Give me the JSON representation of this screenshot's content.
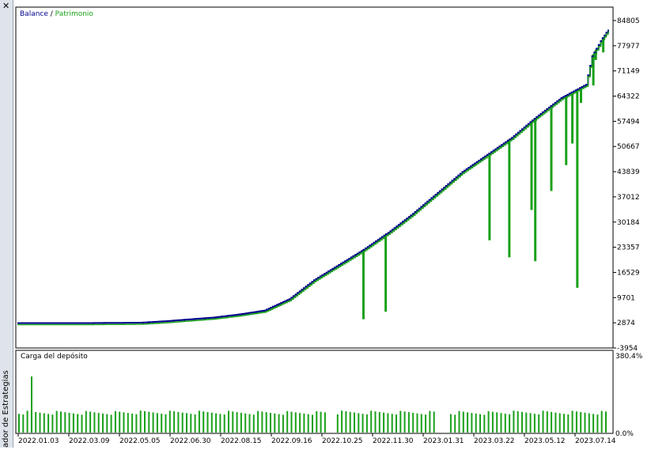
{
  "window": {
    "side_title": "ador de Estrategias",
    "close_glyph": "✕"
  },
  "legend": {
    "balance_label": "Balance",
    "separator": " / ",
    "equity_label": "Patrimonio",
    "balance_color": "#00008b",
    "equity_color": "#1aa11a"
  },
  "lower_panel": {
    "title": "Carga del depósito",
    "bar_color": "#1aa11a"
  },
  "chart_data": [
    {
      "type": "line",
      "series": [
        {
          "name": "Balance",
          "color": "#00008b"
        },
        {
          "name": "Patrimonio",
          "color": "#1aa11a"
        }
      ],
      "x": [
        "2022.01.03",
        "2022.03.09",
        "2022.05.05",
        "2022.06.30",
        "2022.08.15",
        "2022.09.16",
        "2022.10.25",
        "2022.11.30",
        "2023.01.31",
        "2023.03.22",
        "2023.05.12",
        "2023.07.14"
      ],
      "balance_points": [
        [
          0,
          2200
        ],
        [
          6,
          2200
        ],
        [
          10,
          2300
        ],
        [
          12,
          2700
        ],
        [
          16,
          3700
        ],
        [
          18,
          4500
        ],
        [
          20,
          5500
        ],
        [
          21,
          7000
        ],
        [
          22,
          8500
        ],
        [
          23,
          11000
        ],
        [
          24,
          13500
        ],
        [
          26,
          17500
        ],
        [
          28,
          21500
        ],
        [
          30,
          26000
        ],
        [
          32,
          31000
        ],
        [
          34,
          36500
        ],
        [
          36,
          42000
        ],
        [
          38,
          46500
        ],
        [
          40,
          51000
        ],
        [
          42,
          56500
        ],
        [
          44,
          61500
        ],
        [
          46,
          65000
        ],
        [
          46.5,
          72500
        ],
        [
          47.2,
          76500
        ],
        [
          47.8,
          79500
        ]
      ],
      "equity_drawdowns": [
        [
          28.0,
          3200
        ],
        [
          29.8,
          5200
        ],
        [
          38.2,
          24000
        ],
        [
          39.8,
          19500
        ],
        [
          41.6,
          32000
        ],
        [
          41.9,
          18500
        ],
        [
          43.2,
          37000
        ],
        [
          44.4,
          43800
        ],
        [
          44.9,
          49500
        ],
        [
          45.3,
          11500
        ],
        [
          45.6,
          60200
        ],
        [
          46.6,
          64800
        ],
        [
          46.8,
          71500
        ],
        [
          47.4,
          73500
        ]
      ],
      "y_ticks": [
        "84805",
        "77977",
        "71149",
        "64322",
        "57494",
        "50667",
        "43839",
        "37012",
        "30184",
        "23357",
        "16529",
        "9701",
        "2874",
        "-3954"
      ],
      "ylim": [
        -3954,
        84805
      ],
      "x_ticks": [
        "2022.01.03",
        "2022.03.09",
        "2022.05.05",
        "2022.06.30",
        "2022.08.15",
        "2022.09.16",
        "2022.10.25",
        "2022.11.30",
        "2023.01.31",
        "2023.03.22",
        "2023.05.12",
        "2023.07.14"
      ],
      "grid": false,
      "legend_position": "top-left"
    },
    {
      "type": "bar",
      "title": "Carga del depósito",
      "y_ticks": [
        "380.4%",
        "0.0%"
      ],
      "ylim": [
        0,
        380.4
      ],
      "spike_value": 270,
      "typical_value": 95
    }
  ]
}
